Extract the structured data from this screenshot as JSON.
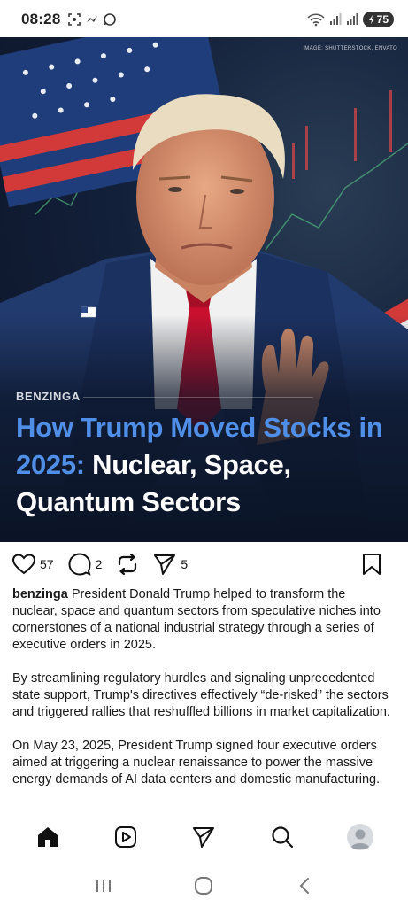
{
  "status_bar": {
    "time": "08:28",
    "battery": "75",
    "left_icons": [
      "screenshot-icon",
      "messenger-icon",
      "whatsapp-icon"
    ],
    "right_icons": [
      "wifi-icon",
      "signal-icon",
      "signal-icon-2",
      "battery-icon"
    ]
  },
  "post": {
    "image_credit": "IMAGE: SHUTTERSTOCK, ENVATO",
    "kicker": "BENZINGA",
    "headline_highlight": "How Trump Moved Stocks in 2025:",
    "headline_rest": "Nuclear, Space, Quantum Sectors",
    "likes": "57",
    "comments": "2",
    "shares": "5",
    "username": "benzinga",
    "caption_paragraphs": [
      "President Donald Trump helped to transform the nuclear, space and quantum sectors from speculative niches into cornerstones of a national industrial strategy through a series of executive orders in 2025.",
      "By streamlining regulatory hurdles and signaling unprecedented state support, Trump's directives effectively “de-risked” the sectors and triggered rallies that reshuffled billions in market capitalization.",
      "On May 23, 2025, President Trump signed four executive orders aimed at triggering a nuclear renaissance to power the massive energy demands of AI data centers and domestic manufacturing."
    ]
  },
  "bottom_nav": {
    "items": [
      "home-icon",
      "reels-icon",
      "send-icon",
      "search-icon",
      "profile-avatar"
    ]
  },
  "system_nav": {
    "items": [
      "recent-apps-icon",
      "home-button-icon",
      "back-icon"
    ]
  },
  "colors": {
    "headline_blue": "#4f8fe8",
    "hero_bg": "#13203a",
    "tie_red": "#c8102e"
  }
}
